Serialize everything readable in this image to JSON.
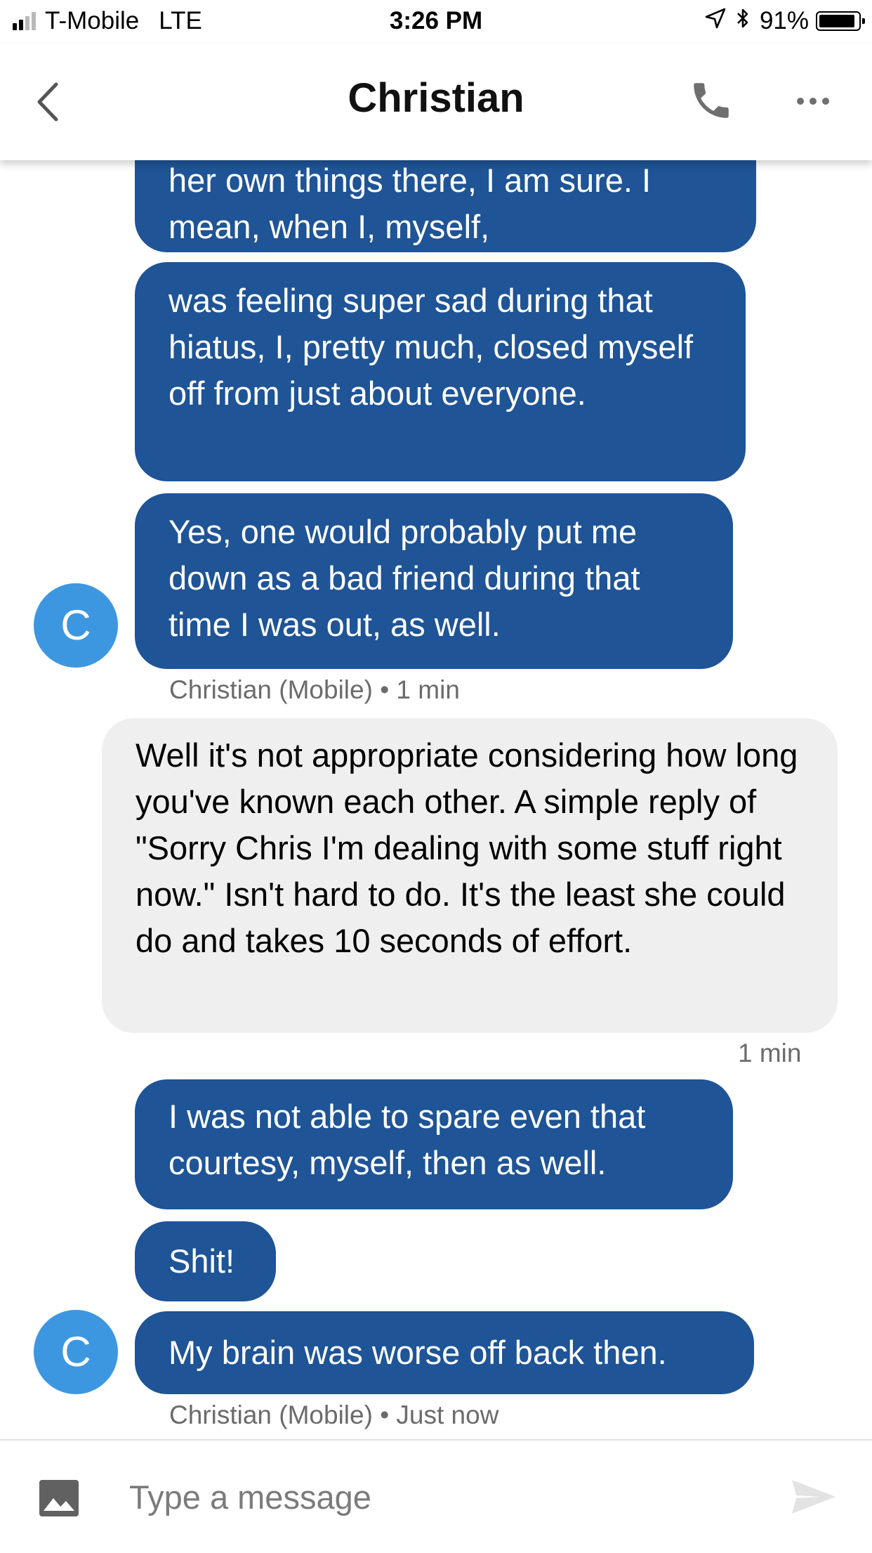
{
  "status_bar": {
    "carrier": "T-Mobile",
    "network": "LTE",
    "time": "3:26 PM",
    "battery": "91%",
    "battery_level": 0.91,
    "signal_bars": 2,
    "icons": [
      "signal-icon",
      "location-arrow-icon",
      "bluetooth-icon",
      "battery-icon"
    ]
  },
  "header": {
    "title": "Christian",
    "icons": [
      "back-chevron-icon",
      "phone-icon",
      "more-dots-icon"
    ]
  },
  "messages": [
    {
      "sender": "other",
      "text": "her own things there, I am sure.  I mean, when I, myself,"
    },
    {
      "sender": "other",
      "text": "was feeling super sad during that hiatus, I, pretty much, closed myself off from just about everyone."
    },
    {
      "sender": "other",
      "text": "Yes, one would probably put me down as a bad friend during that time I was out, as well."
    },
    {
      "sender": "me",
      "text": "Well it's not appropriate considering how long you've known each other. A simple reply of \"Sorry Chris I'm dealing with some stuff right now.\" Isn't hard to do. It's the least she could do and takes 10 seconds of effort."
    },
    {
      "sender": "other",
      "text": "I was not able to spare even that courtesy, myself, then as well."
    },
    {
      "sender": "other",
      "text": "Shit!"
    },
    {
      "sender": "other",
      "text": "My brain was worse off back then."
    }
  ],
  "meta": {
    "group1": "Christian (Mobile) • 1 min",
    "mine": "1 min",
    "group2": "Christian (Mobile) • Just now"
  },
  "avatar_initial": "C",
  "colors": {
    "outgoing_bubble": "#1f5496",
    "incoming_bubble": "#efefef",
    "avatar": "#3d97e0"
  },
  "composer": {
    "placeholder": "Type a message",
    "value": ""
  }
}
